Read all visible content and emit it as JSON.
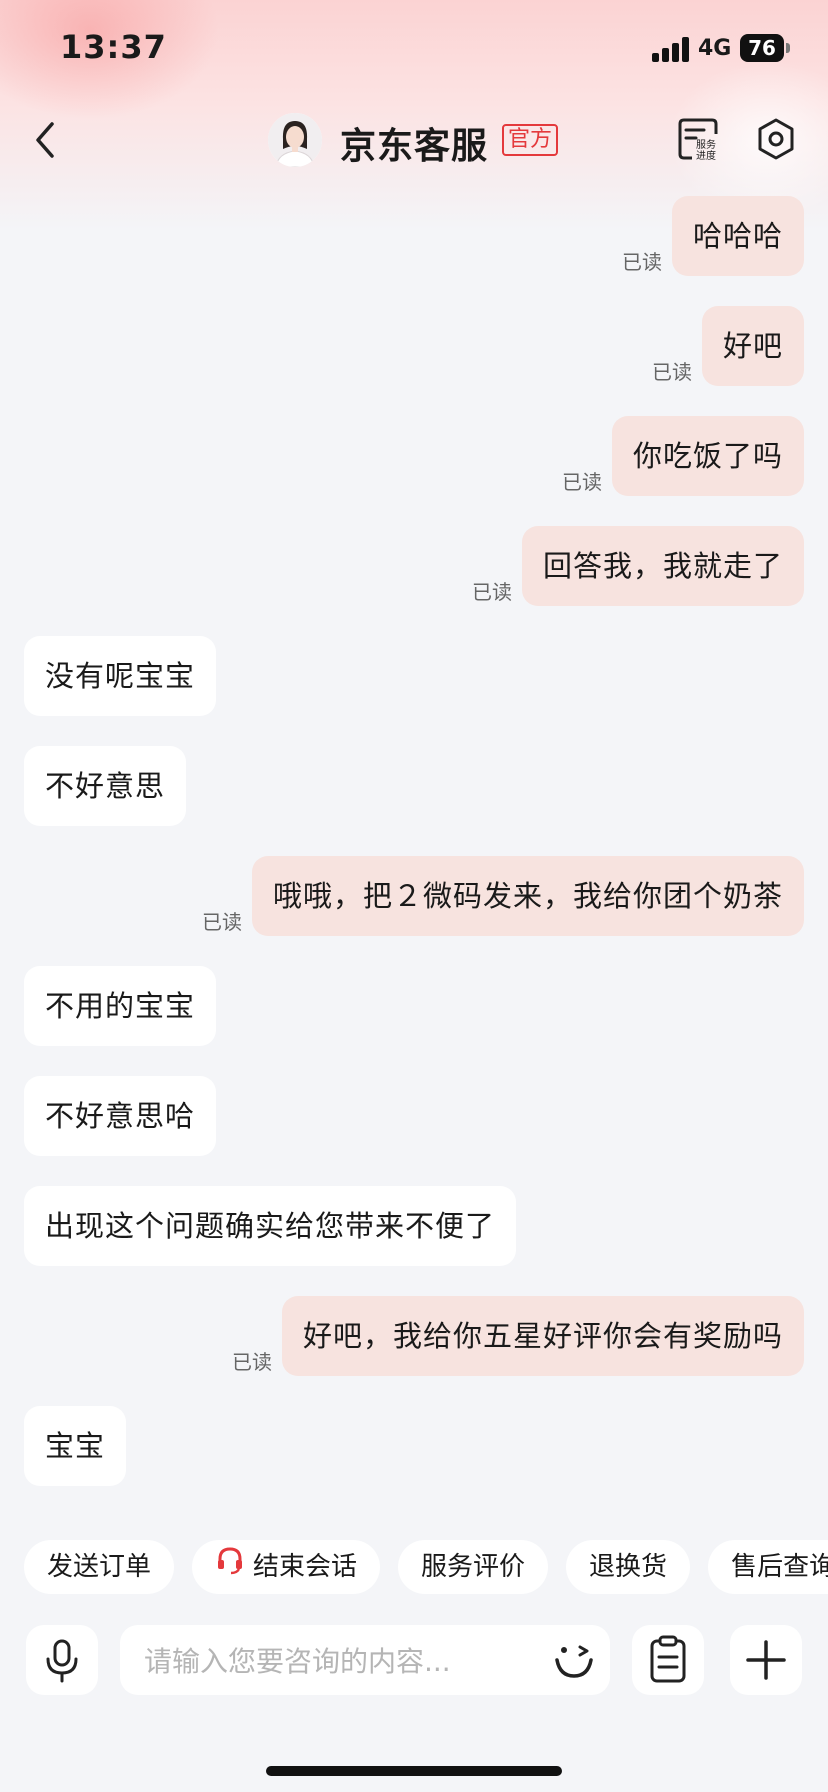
{
  "status_bar": {
    "time": "13:37",
    "network": "4G",
    "battery": "76"
  },
  "header": {
    "title": "京东客服",
    "badge": "官方",
    "progress_label": "服务进度"
  },
  "messages": [
    {
      "side": "out",
      "text": "哈哈哈",
      "status": "已读"
    },
    {
      "side": "out",
      "text": "好吧",
      "status": "已读"
    },
    {
      "side": "out",
      "text": "你吃饭了吗",
      "status": "已读"
    },
    {
      "side": "out",
      "text": "回答我，我就走了",
      "status": "已读"
    },
    {
      "side": "in",
      "text": "没有呢宝宝"
    },
    {
      "side": "in",
      "text": "不好意思"
    },
    {
      "side": "out",
      "text": "哦哦，把２微码发来，我给你团个奶茶",
      "status": "已读"
    },
    {
      "side": "in",
      "text": "不用的宝宝"
    },
    {
      "side": "in",
      "text": "不好意思哈"
    },
    {
      "side": "in",
      "text": "出现这个问题确实给您带来不便了"
    },
    {
      "side": "out",
      "text": "好吧，我给你五星好评你会有奖励吗",
      "status": "已读"
    },
    {
      "side": "in",
      "text": "宝宝"
    }
  ],
  "quick_actions": [
    "发送订单",
    "结束会话",
    "服务评价",
    "退换货",
    "售后查询"
  ],
  "input": {
    "placeholder": "请输入您要咨询的内容..."
  },
  "colors": {
    "accent": "#e4393c",
    "outgoing_bubble": "#f7e3df",
    "incoming_bubble": "#ffffff",
    "background": "#f4f5f8"
  },
  "icons": [
    "back-icon",
    "service-progress-icon",
    "settings-icon",
    "headset-icon",
    "microphone-icon",
    "emoji-icon",
    "clipboard-icon",
    "plus-icon"
  ]
}
